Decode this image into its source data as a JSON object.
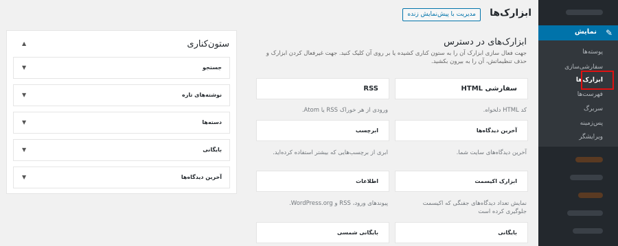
{
  "header": {
    "title": "ابزارک‌ها",
    "live_preview": "مدیریت با پیش‌نمایش زنده"
  },
  "admin_menu": {
    "active_label": "نمایش",
    "submenu": [
      {
        "label": "پوسته‌ها"
      },
      {
        "label": "سفارشی‌سازی"
      },
      {
        "label": "ابزارک‌ها"
      },
      {
        "label": "فهرست‌ها"
      },
      {
        "label": "سربرگ"
      },
      {
        "label": "پس‌زمینه"
      },
      {
        "label": "ویرایشگر"
      }
    ]
  },
  "available": {
    "title": "ابزارک‌های در دسترس",
    "description": "جهت فعال سازی ابزارک آن را به ستون کناری کشیده یا بر روی آن کلیک کنید. جهت غیرفعال کردن ابزارک و حذف تنظیماتش، آن را به بیرون بکشید.",
    "widgets": [
      {
        "name": "HTML سفارشی",
        "desc": "کد HTML دلخواه."
      },
      {
        "name": "RSS",
        "desc": "ورودی از هر خوراک RSS یا Atom."
      },
      {
        "name": "آخرین دیدگاه‌ها",
        "desc": "آخرین دیدگاه‌های سایت شما."
      },
      {
        "name": "ابرچسب",
        "desc": "ابری از برچسب‌هایی که بیشتر استفاده کرده‌اید."
      },
      {
        "name": "ابزارک اکیسمت",
        "desc": "نمایش تعداد دیدگاه‌های جفنگی که اکیسمت جلوگیری کرده است"
      },
      {
        "name": "اطلاعات",
        "desc": "پیوندهای ورود، RSS و WordPress.org."
      },
      {
        "name": "بایگانی",
        "desc": ""
      },
      {
        "name": "بایگانی شمسی",
        "desc": ""
      }
    ]
  },
  "sidebar_area": {
    "title": "ستون‌کناری",
    "items": [
      {
        "name": "جستجو"
      },
      {
        "name": "نوشته‌های تازه"
      },
      {
        "name": "دسته‌ها"
      },
      {
        "name": "بایگانی"
      },
      {
        "name": "آخرین دیدگاه‌ها"
      }
    ]
  },
  "icons": {
    "appearance": "paintbrush-icon",
    "expand": "triangle-down-icon",
    "collapse": "triangle-up-icon"
  },
  "colors": {
    "admin_bg": "#23282d",
    "active": "#0073aa",
    "highlight": "#e01111"
  }
}
